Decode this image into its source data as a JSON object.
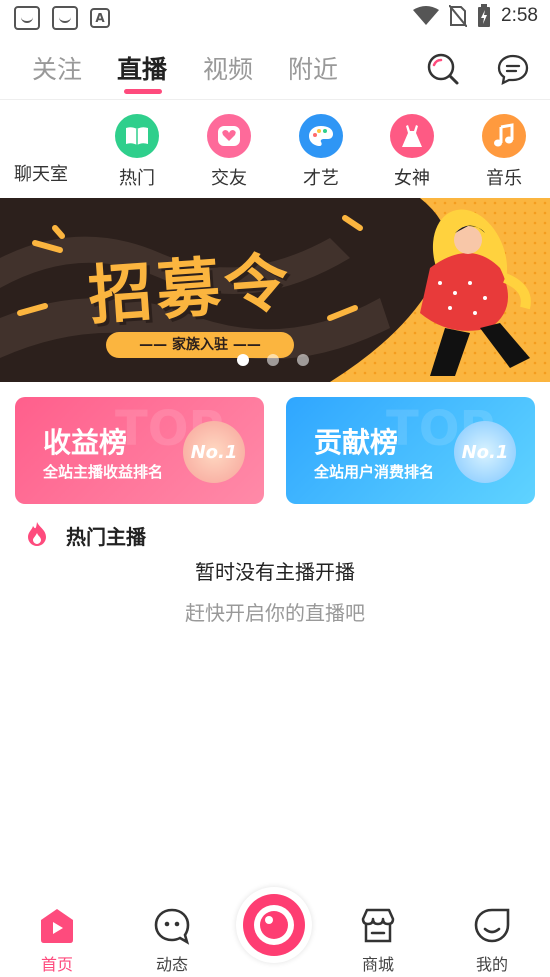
{
  "status_bar": {
    "time": "2:58",
    "icons": [
      "face-icon",
      "face-icon",
      "font-icon",
      "wifi-icon",
      "no-sim-icon",
      "battery-charging-icon"
    ]
  },
  "top_tabs": [
    {
      "label": "关注",
      "active": false
    },
    {
      "label": "直播",
      "active": true
    },
    {
      "label": "视频",
      "active": false
    },
    {
      "label": "附近",
      "active": false
    }
  ],
  "top_icons": [
    "search-icon",
    "message-icon"
  ],
  "categories": [
    {
      "label": "聊天室",
      "icon": "none"
    },
    {
      "label": "热门",
      "icon": "book-icon",
      "color": "#2fcf8c"
    },
    {
      "label": "交友",
      "icon": "heart-icon",
      "color": "#fe6a9a"
    },
    {
      "label": "才艺",
      "icon": "palette-icon",
      "color": "#2f96f5"
    },
    {
      "label": "女神",
      "icon": "dress-icon",
      "color": "#fe5a84"
    },
    {
      "label": "音乐",
      "icon": "music-icon",
      "color": "#ff9a3e"
    }
  ],
  "banner": {
    "title": "招募令",
    "subtitle": "—— 家族入驻 ——",
    "pages": 3,
    "active_page": 1
  },
  "rank_cards": [
    {
      "title": "收益榜",
      "subtitle": "全站主播收益排名",
      "badge": "No.1",
      "bg_text": "TOP",
      "colors": [
        "#ff5f8c",
        "#ff8aa8"
      ]
    },
    {
      "title": "贡献榜",
      "subtitle": "全站用户消费排名",
      "badge": "No.1",
      "bg_text": "TOP",
      "colors": [
        "#2fa6ff",
        "#5fd3ff"
      ]
    }
  ],
  "hot_section": {
    "title": "热门主播",
    "empty_main": "暂时没有主播开播",
    "empty_sub": "赶快开启你的直播吧"
  },
  "bottom_nav": [
    {
      "label": "首页",
      "icon": "home-icon",
      "active": true
    },
    {
      "label": "动态",
      "icon": "chat-face-icon",
      "active": false
    },
    {
      "label": "",
      "icon": "live-camera-icon",
      "active": false
    },
    {
      "label": "商城",
      "icon": "shop-icon",
      "active": false
    },
    {
      "label": "我的",
      "icon": "profile-icon",
      "active": false
    }
  ],
  "colors": {
    "accent": "#fe4b7d",
    "banner_bg": "#fbb53f"
  }
}
